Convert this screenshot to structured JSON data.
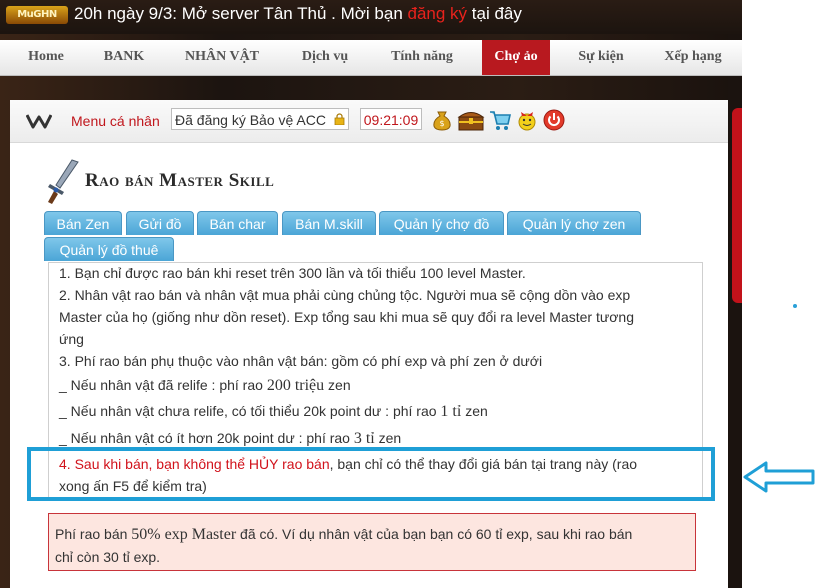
{
  "topbar": {
    "logo_text": "MuGHN",
    "announce_prefix": "20h ngày 9/3: Mở server Tân Thủ . Mời bạn ",
    "announce_link": "đăng ký",
    "announce_suffix": " tại đây"
  },
  "nav": {
    "items": [
      "Home",
      "BANK",
      "NHÂN VẬT",
      "Dịch vụ",
      "Tính năng",
      "Chợ ảo",
      "Sự kiện",
      "Xếp hạng"
    ],
    "active_index": 5
  },
  "toolbar": {
    "menu_label": "Menu cá nhân",
    "status_text": "Đã đăng ký Bảo vệ ACC",
    "clock": "09:21:09",
    "icons": [
      "money-bag-icon",
      "treasure-chest-icon",
      "shopping-cart-icon",
      "gift-icon",
      "power-icon"
    ]
  },
  "heading": "Rao bán Master Skill",
  "tabs": [
    "Bán Zen",
    "Gửi đồ",
    "Bán char",
    "Bán M.skill",
    "Quản lý chợ đồ",
    "Quản lý chợ zen",
    "Quản lý đồ thuê"
  ],
  "rules": {
    "r1": "1. Bạn chỉ được rao bán khi reset trên 300 lần và tối thiểu 100 level Master.",
    "r2a": "2. Nhân vật rao bán và nhân vật mua phải cùng chủng tộc. Người mua sẽ cộng dồn vào exp",
    "r2b": "Master của họ (giống như dồn reset). Exp tổng sau khi mua sẽ quy đổi ra level Master tương",
    "r2c": "ứng",
    "r3": "3. Phí rao bán phụ thuộc vào nhân vật bán: gồm có phí exp và phí zen ở dưới",
    "f1_prefix": "_ Nếu nhân vật đã relife : phí rao ",
    "f1_amount": "200 triệu",
    "f1_suffix": " zen",
    "f2_prefix": "_ Nếu nhân vật chưa relife, có tối thiểu 20k point dư : phí rao ",
    "f2_amount": "1 tỉ",
    "f2_suffix": " zen",
    "f3_prefix": "_ Nếu nhân vật có ít hơn 20k point dư : phí rao ",
    "f3_amount": "3 tỉ",
    "f3_suffix": " zen",
    "r4_red": "4. Sau khi bán, bạn không thể HỦY rao bán",
    "r4_rest": ", bạn chỉ có thể thay đổi giá bán tại trang này (rao",
    "r4b": "xong ấn F5 để kiểm tra)"
  },
  "notice": {
    "prefix": "Phí rao bán ",
    "amount": "50% exp Master",
    "line1_rest": " đã có. Ví dụ nhân vật của bạn bạn có 60 tỉ exp, sau khi rao bán",
    "line2": "chỉ còn 30 tỉ exp."
  },
  "colors": {
    "accent_red": "#b8191f",
    "highlight_blue": "#1f9fd6",
    "tab_blue": "#4ba5d6"
  }
}
